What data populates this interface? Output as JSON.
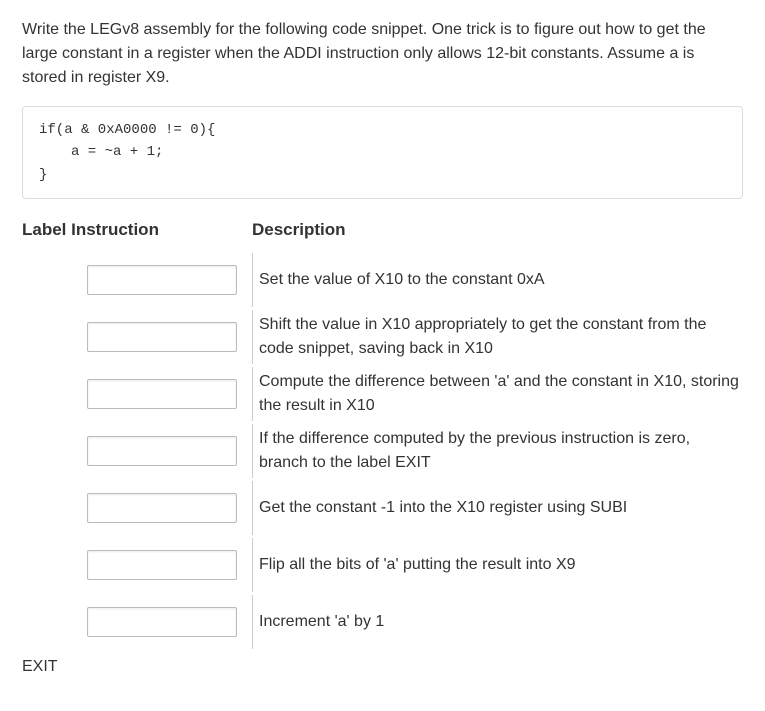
{
  "intro": {
    "text": "Write the LEGv8 assembly for the following code snippet.  One trick is to figure out how to get the large constant in a register when the ADDI instruction only allows 12-bit constants.  Assume a is stored in register X9."
  },
  "code": {
    "line1": "if(a & 0xA0000 != 0){",
    "line2": "a = ~a + 1;",
    "line3": "}"
  },
  "headers": {
    "label": "Label Instruction",
    "description": "Description"
  },
  "rows": [
    {
      "label": "",
      "input": "",
      "description": "Set the value of X10 to the constant 0xA"
    },
    {
      "label": "",
      "input": "",
      "description": "Shift the value in X10 appropriately to get the constant from the code snippet, saving back in X10"
    },
    {
      "label": "",
      "input": "",
      "description": "Compute the difference between 'a' and the constant in X10, storing the result in X10"
    },
    {
      "label": "",
      "input": "",
      "description": "If the difference computed by the previous instruction is zero, branch to the label EXIT"
    },
    {
      "label": "",
      "input": "",
      "description": "Get the constant -1 into the X10 register using SUBI"
    },
    {
      "label": "",
      "input": "",
      "description": "Flip all the bits of 'a' putting the result into X9"
    },
    {
      "label": "",
      "input": "",
      "description": "Increment 'a' by 1"
    }
  ],
  "exit_label": "EXIT"
}
